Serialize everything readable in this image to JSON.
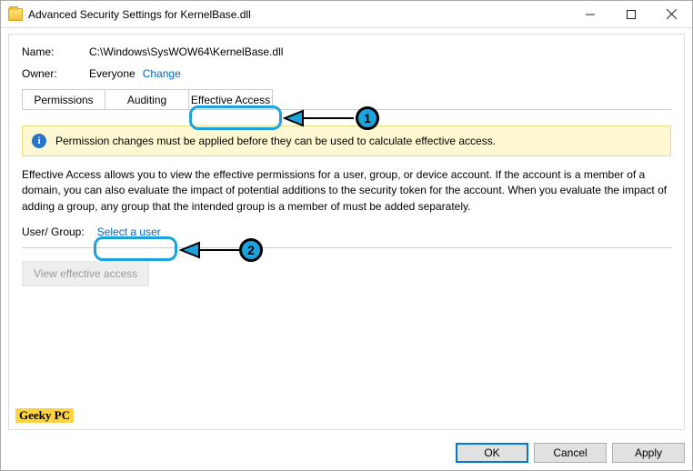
{
  "window": {
    "title": "Advanced Security Settings for KernelBase.dll"
  },
  "header": {
    "name_label": "Name:",
    "name_value": "C:\\Windows\\SysWOW64\\KernelBase.dll",
    "owner_label": "Owner:",
    "owner_value": "Everyone",
    "change_link": "Change"
  },
  "tabs": {
    "items": [
      {
        "label": "Permissions"
      },
      {
        "label": "Auditing"
      },
      {
        "label": "Effective Access"
      }
    ]
  },
  "info_message": "Permission changes must be applied before they can be used to calculate effective access.",
  "description": "Effective Access allows you to view the effective permissions for a user, group, or device account. If the account is a member of a domain, you can also evaluate the impact of potential additions to the security token for the account. When you evaluate the impact of adding a group, any group that the intended group is a member of must be added separately.",
  "user_group": {
    "label": "User/ Group:",
    "select_link": "Select a user"
  },
  "view_btn": "View effective access",
  "footer": {
    "ok": "OK",
    "cancel": "Cancel",
    "apply": "Apply"
  },
  "annotations": {
    "one": "1",
    "two": "2"
  },
  "watermark": "Geeky PC"
}
